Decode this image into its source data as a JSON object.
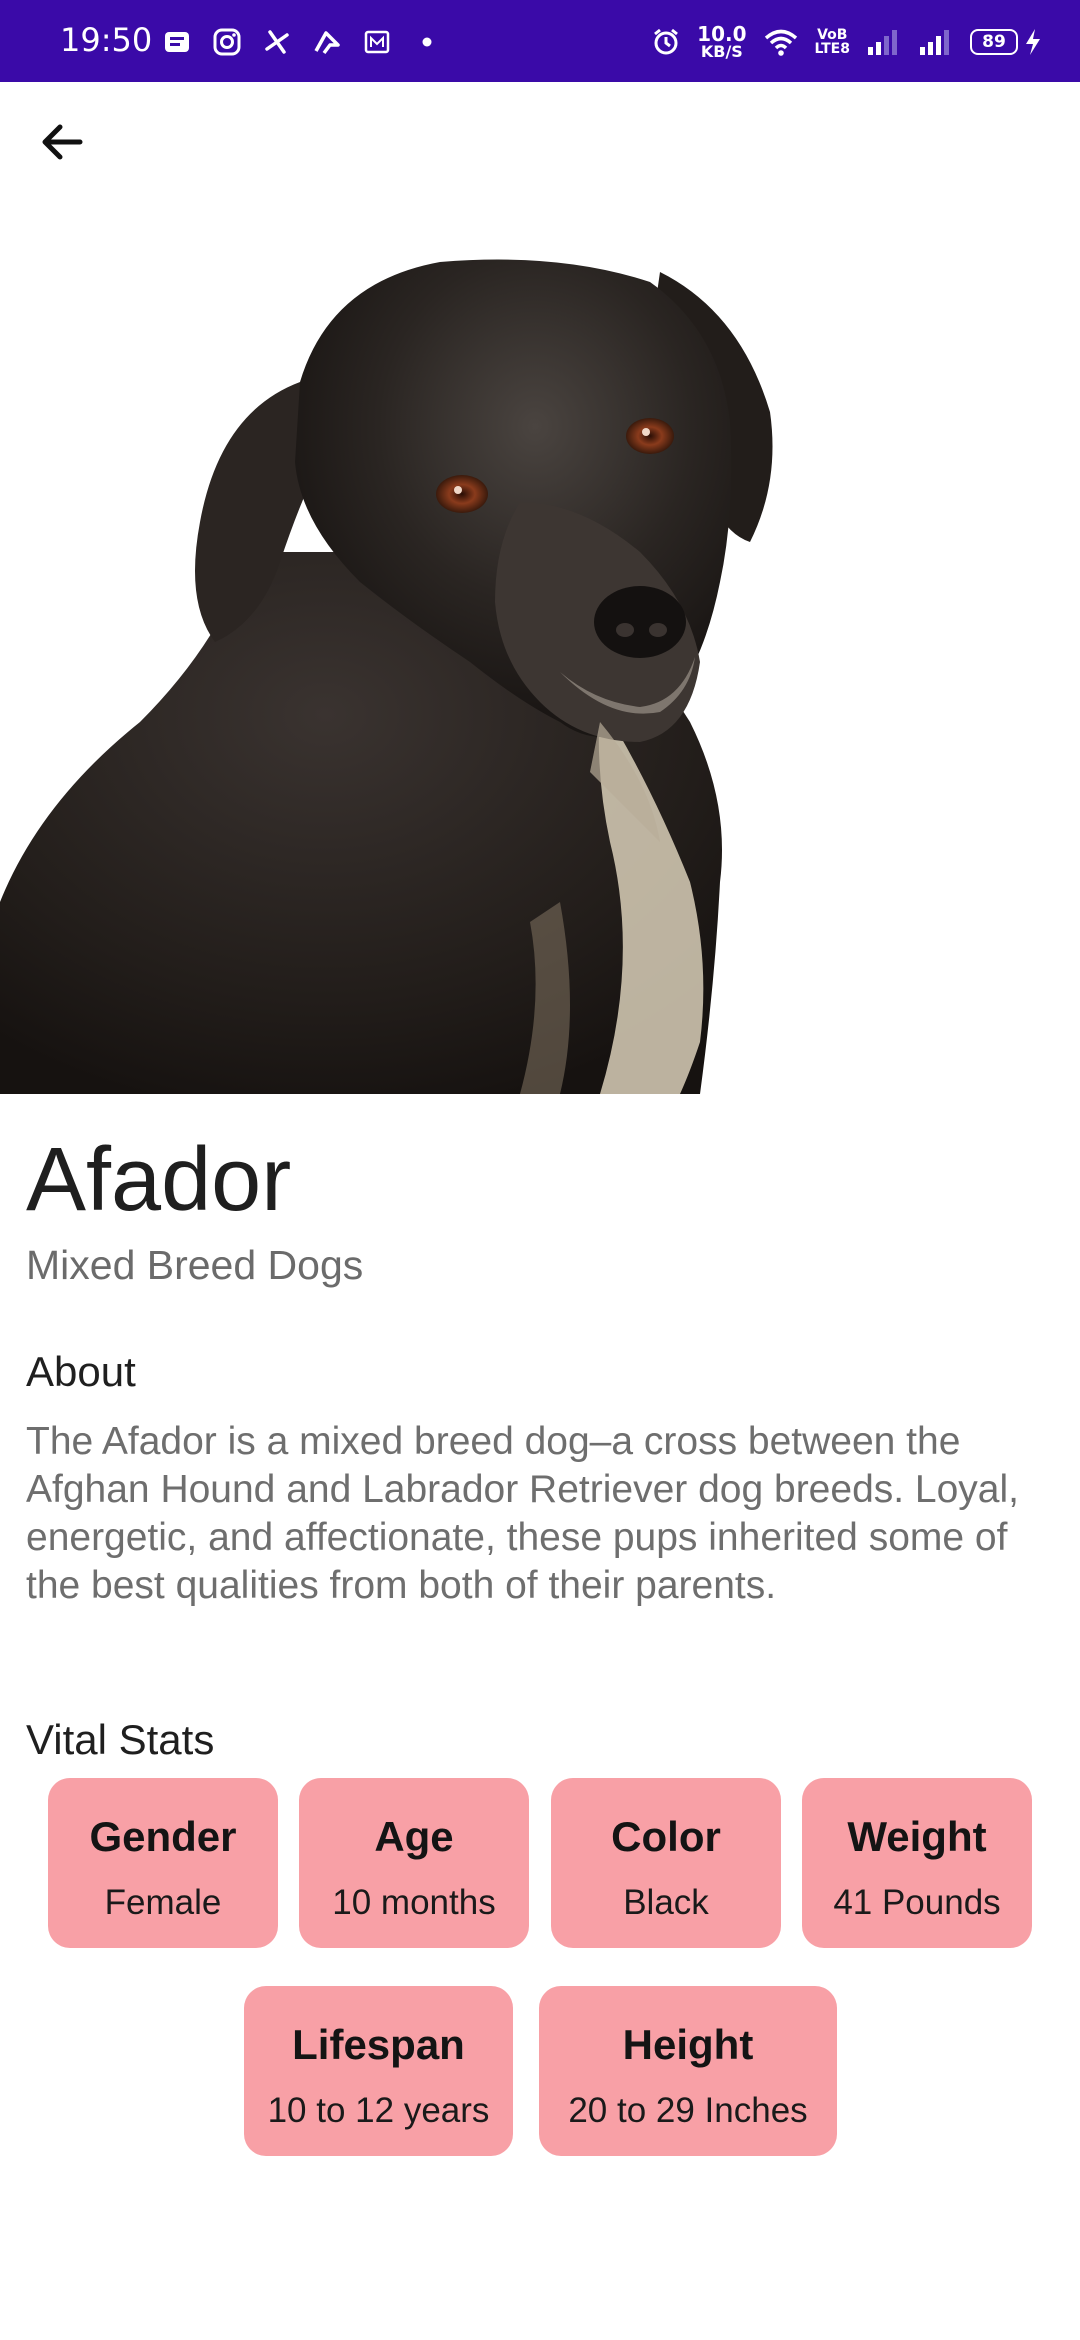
{
  "status_bar": {
    "time": "19:50",
    "net_speed_value": "10.0",
    "net_speed_unit": "KB/S",
    "volte_top": "VoB",
    "volte_bottom": "LTE8",
    "battery": "89",
    "background_color": "#3a0aa8"
  },
  "header": {
    "back_icon": "arrow-left-icon"
  },
  "breed": {
    "name": "Afador",
    "group": "Mixed Breed Dogs"
  },
  "about": {
    "title": "About",
    "text": "The Afador is a mixed breed dog–a cross between the Afghan Hound and Labrador Retriever dog breeds. Loyal, energetic, and affectionate, these pups inherited some of the best qualities from both of their parents."
  },
  "vital_stats": {
    "title": "Vital Stats",
    "card_color": "#f8a0a6",
    "items": [
      {
        "label": "Gender",
        "value": "Female"
      },
      {
        "label": "Age",
        "value": "10 months"
      },
      {
        "label": "Color",
        "value": "Black"
      },
      {
        "label": "Weight",
        "value": "41 Pounds"
      },
      {
        "label": "Lifespan",
        "value": "10 to 12 years"
      },
      {
        "label": "Height",
        "value": "20 to 29 Inches"
      }
    ]
  }
}
